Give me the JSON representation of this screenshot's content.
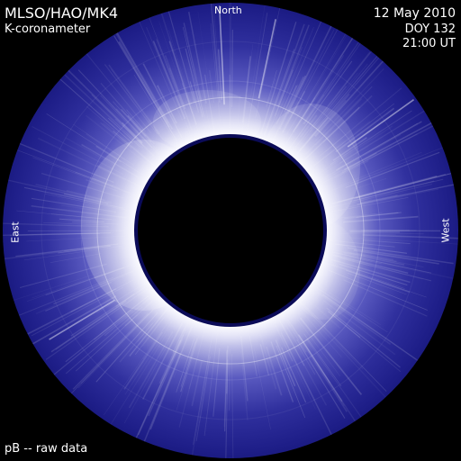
{
  "header": {
    "instrument": "MLSO/HAO/MK4",
    "product": "K-coronameter"
  },
  "timestamp": {
    "date": "12 May 2010",
    "doy": "DOY 132",
    "time": "21:00 UT"
  },
  "orientation": {
    "north": "North",
    "east": "East",
    "west": "West"
  },
  "footer": {
    "caption": "pB -- raw data"
  },
  "colors": {
    "background": "#000000",
    "corona_dark": "#1c1c86",
    "corona_mid": "#5050bb",
    "corona_bright": "#d7d7f6",
    "occulter_rim": "#0b0b58",
    "text": "#ffffff"
  }
}
